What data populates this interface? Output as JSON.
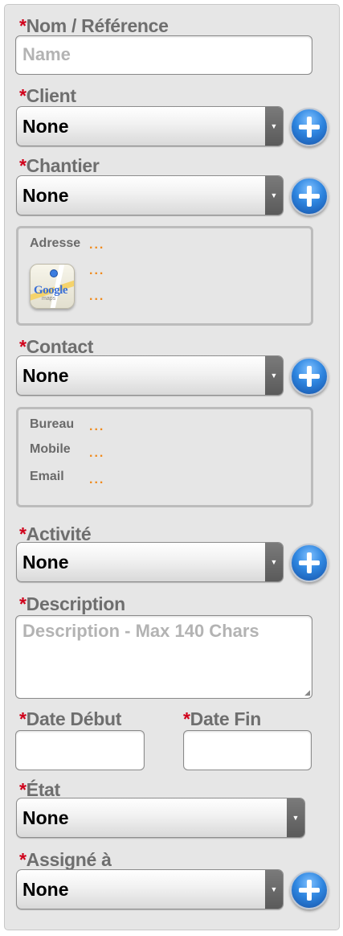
{
  "form": {
    "name": {
      "label": "Nom / Référence",
      "placeholder": "Name",
      "value": ""
    },
    "client": {
      "label": "Client",
      "value": "None"
    },
    "chantier": {
      "label": "Chantier",
      "value": "None"
    },
    "address_box": {
      "adresse_label": "Adresse",
      "lines": [
        "...",
        "...",
        "..."
      ],
      "maps_text": "Google",
      "maps_sub": "maps"
    },
    "contact": {
      "label": "Contact",
      "value": "None"
    },
    "contact_box": {
      "bureau_label": "Bureau",
      "mobile_label": "Mobile",
      "email_label": "Email",
      "bureau_value": "...",
      "mobile_value": "...",
      "email_value": "..."
    },
    "activite": {
      "label": "Activité",
      "value": "None"
    },
    "description": {
      "label": "Description",
      "placeholder": "Description - Max 140 Chars",
      "value": ""
    },
    "date_debut": {
      "label": "Date Début",
      "value": ""
    },
    "date_fin": {
      "label": "Date Fin",
      "value": ""
    },
    "etat": {
      "label": "État",
      "value": "None"
    },
    "assigne": {
      "label": "Assigné à",
      "value": "None"
    },
    "required_marker": "*"
  },
  "colors": {
    "panel_bg": "#e6e6e6",
    "label": "#6e6e6e",
    "required": "#d0021b",
    "placeholder": "#b3b3b3",
    "dots": "#f08a1c",
    "plus_button": "#2f86e0"
  },
  "icons": {
    "dropdown": "chevron-down-icon",
    "add": "plus-circle-icon",
    "maps": "google-maps-icon"
  }
}
